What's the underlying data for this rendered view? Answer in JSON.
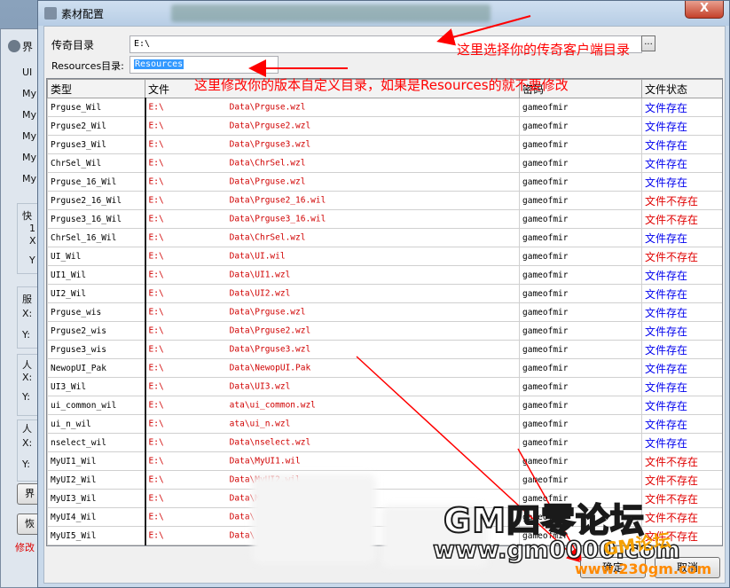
{
  "background_window": {
    "title": "界",
    "labels": [
      "UI",
      "My",
      "My",
      "My",
      "My",
      "My",
      "快",
      "1",
      "X",
      "Y",
      "服",
      "X:",
      "Y:",
      "人",
      "X:",
      "Y:",
      "人",
      "X:",
      "Y:"
    ],
    "button1": "界",
    "button2": "恢",
    "modify_text": "修改"
  },
  "dialog": {
    "title": "素材配置",
    "close_label": "X",
    "legend_dir_label": "传奇目录",
    "legend_dir_value": "E:\\",
    "browse_label": "...",
    "resources_label": "Resources目录:",
    "resources_value": "Resources"
  },
  "annotations": {
    "top": "这里选择你的传奇客户端目录",
    "middle": "这里修改你的版本自定义目录，如果是Resources的就不要修改"
  },
  "table": {
    "headers": [
      "类型",
      "文件",
      "密码",
      "文件状态"
    ],
    "rows": [
      {
        "type": "Prguse_Wil",
        "file_prefix": "E:\\",
        "file_suffix": "Data\\Prguse.wzl",
        "password": "gameofmir",
        "status": "文件存在",
        "ok": true
      },
      {
        "type": "Prguse2_Wil",
        "file_prefix": "E:\\",
        "file_suffix": "Data\\Prguse2.wzl",
        "password": "gameofmir",
        "status": "文件存在",
        "ok": true
      },
      {
        "type": "Prguse3_Wil",
        "file_prefix": "E:\\",
        "file_suffix": "Data\\Prguse3.wzl",
        "password": "gameofmir",
        "status": "文件存在",
        "ok": true
      },
      {
        "type": "ChrSel_Wil",
        "file_prefix": "E:\\",
        "file_suffix": "Data\\ChrSel.wzl",
        "password": "gameofmir",
        "status": "文件存在",
        "ok": true
      },
      {
        "type": "Prguse_16_Wil",
        "file_prefix": "E:\\",
        "file_suffix": "Data\\Prguse.wzl",
        "password": "gameofmir",
        "status": "文件存在",
        "ok": true
      },
      {
        "type": "Prguse2_16_Wil",
        "file_prefix": "E:\\",
        "file_suffix": "Data\\Prguse2_16.wil",
        "password": "gameofmir",
        "status": "文件不存在",
        "ok": false
      },
      {
        "type": "Prguse3_16_Wil",
        "file_prefix": "E:\\",
        "file_suffix": "Data\\Prguse3_16.wil",
        "password": "gameofmir",
        "status": "文件不存在",
        "ok": false
      },
      {
        "type": "ChrSel_16_Wil",
        "file_prefix": "E:\\",
        "file_suffix": "Data\\ChrSel.wzl",
        "password": "gameofmir",
        "status": "文件存在",
        "ok": true
      },
      {
        "type": "UI_Wil",
        "file_prefix": "E:\\",
        "file_suffix": "Data\\UI.wil",
        "password": "gameofmir",
        "status": "文件不存在",
        "ok": false
      },
      {
        "type": "UI1_Wil",
        "file_prefix": "E:\\",
        "file_suffix": "Data\\UI1.wzl",
        "password": "gameofmir",
        "status": "文件存在",
        "ok": true
      },
      {
        "type": "UI2_Wil",
        "file_prefix": "E:\\",
        "file_suffix": "Data\\UI2.wzl",
        "password": "gameofmir",
        "status": "文件存在",
        "ok": true
      },
      {
        "type": "Prguse_wis",
        "file_prefix": "E:\\",
        "file_suffix": "Data\\Prguse.wzl",
        "password": "gameofmir",
        "status": "文件存在",
        "ok": true
      },
      {
        "type": "Prguse2_wis",
        "file_prefix": "E:\\",
        "file_suffix": "Data\\Prguse2.wzl",
        "password": "gameofmir",
        "status": "文件存在",
        "ok": true
      },
      {
        "type": "Prguse3_wis",
        "file_prefix": "E:\\",
        "file_suffix": "Data\\Prguse3.wzl",
        "password": "gameofmir",
        "status": "文件存在",
        "ok": true
      },
      {
        "type": "NewopUI_Pak",
        "file_prefix": "E:\\",
        "file_suffix": "Data\\NewopUI.Pak",
        "password": "gameofmir",
        "status": "文件存在",
        "ok": true
      },
      {
        "type": "UI3_Wil",
        "file_prefix": "E:\\",
        "file_suffix": "Data\\UI3.wzl",
        "password": "gameofmir",
        "status": "文件存在",
        "ok": true
      },
      {
        "type": "ui_common_wil",
        "file_prefix": "E:\\",
        "file_suffix": "ata\\ui_common.wzl",
        "password": "gameofmir",
        "status": "文件存在",
        "ok": true
      },
      {
        "type": "ui_n_wil",
        "file_prefix": "E:\\",
        "file_suffix": "ata\\ui_n.wzl",
        "password": "gameofmir",
        "status": "文件存在",
        "ok": true
      },
      {
        "type": "nselect_wil",
        "file_prefix": "E:\\",
        "file_suffix": "Data\\nselect.wzl",
        "password": "gameofmir",
        "status": "文件存在",
        "ok": true
      },
      {
        "type": "MyUI1_Wil",
        "file_prefix": "E:\\",
        "file_suffix": "Data\\MyUI1.wil",
        "password": "gameofmir",
        "status": "文件不存在",
        "ok": false
      },
      {
        "type": "MyUI2_Wil",
        "file_prefix": "E:\\",
        "file_suffix": "Data\\MyUI2.wil",
        "password": "gameofmir",
        "status": "文件不存在",
        "ok": false
      },
      {
        "type": "MyUI3_Wil",
        "file_prefix": "E:\\",
        "file_suffix": "Data\\MyUI3.wil",
        "password": "gameofmir",
        "status": "文件不存在",
        "ok": false
      },
      {
        "type": "MyUI4_Wil",
        "file_prefix": "E:\\",
        "file_suffix": "Data\\",
        "password": "gameofmir",
        "status": "文件不存在",
        "ok": false
      },
      {
        "type": "MyUI5_Wil",
        "file_prefix": "E:\\",
        "file_suffix": "Data\\",
        "password": "gameofmir",
        "status": "文件不存在",
        "ok": false
      }
    ]
  },
  "footer": {
    "ok_label": "确定",
    "cancel_label": "取消"
  },
  "watermark": {
    "title": "GM四零论坛",
    "url": "www.gm0000.com",
    "logo": "GM论坛",
    "site": "www.230gm.com"
  },
  "colors": {
    "ok_status": "#0000ee",
    "bad_status": "#e00000",
    "file_path": "#d00000",
    "annotation": "#ff0000"
  }
}
